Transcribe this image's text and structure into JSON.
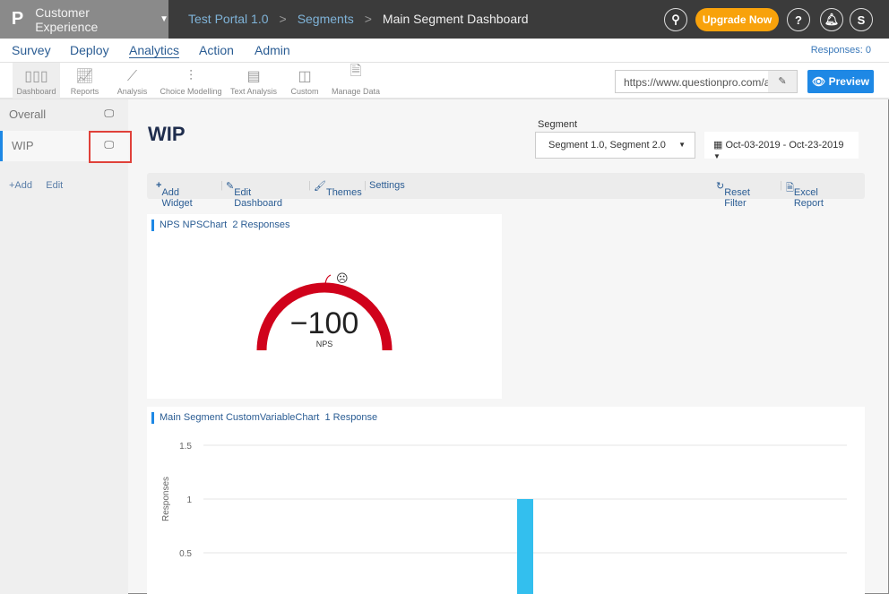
{
  "topbar": {
    "logo": "P",
    "product": "Customer Experience",
    "breadcrumb": [
      "Test Portal 1.0",
      "Segments",
      "Main Segment Dashboard"
    ],
    "upgrade": "Upgrade Now",
    "avatar": "S",
    "help": "?"
  },
  "nav": {
    "items": [
      "Survey",
      "Deploy",
      "Analytics",
      "Action",
      "Admin"
    ],
    "active": "Analytics",
    "responses": "Responses: 0"
  },
  "toolbar": {
    "items": [
      {
        "label": "Dashboard",
        "icon": "bar-chart-icon"
      },
      {
        "label": "Reports",
        "icon": "line-chart-icon"
      },
      {
        "label": "Analysis",
        "icon": "analysis-icon"
      },
      {
        "label": "Choice Modelling",
        "icon": "choice-modelling-icon"
      },
      {
        "label": "Text Analysis",
        "icon": "text-analysis-icon"
      },
      {
        "label": "Custom",
        "icon": "custom-icon"
      },
      {
        "label": "Manage Data",
        "icon": "excel-icon"
      }
    ],
    "url": "https://www.questionpro.com/a/",
    "preview": "Preview"
  },
  "sidebar": {
    "items": [
      "Overall",
      "WIP"
    ],
    "selected": "WIP",
    "add": "+Add",
    "edit": "Edit"
  },
  "main": {
    "title": "WIP",
    "segment_label": "Segment",
    "segment_value": "Segment 1.0, Segment 2.0",
    "date_range": "Oct-03-2019 - Oct-23-2019",
    "actions": [
      "Add Widget",
      "Edit Dashboard",
      "Themes",
      "Settings"
    ],
    "reset": "Reset Filter",
    "excel": "Excel Report"
  },
  "nps_widget": {
    "title": "NPS NPSChart",
    "responses": "2 Responses",
    "value": "−100",
    "label": "NPS",
    "color": "#d0021b"
  },
  "bar_widget": {
    "title": "Main Segment CustomVariableChart",
    "responses": "1 Response"
  },
  "chart_data": {
    "type": "bar",
    "ylabel": "Responses",
    "yticks": [
      "1.5",
      "1",
      "0.5"
    ],
    "ylim": [
      0,
      1.5
    ],
    "values": [
      1
    ],
    "color": "#33bfee",
    "grid": true
  }
}
